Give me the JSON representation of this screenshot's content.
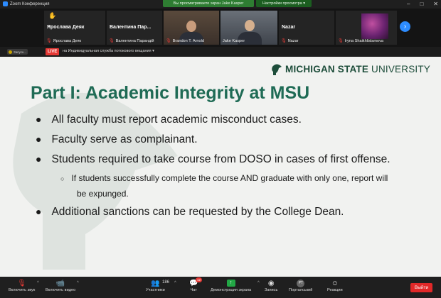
{
  "window": {
    "title": "Zoom Конференция",
    "sharing_banner": "Вы просматриваете экран Jake Kasper",
    "view_options": "Настройки просмотра ▾"
  },
  "gallery": {
    "tiles": [
      {
        "display_name": "Ярослава Деяк",
        "label": "Ярослава Деяк",
        "mic_muted": true,
        "hand_raised": true
      },
      {
        "display_name": "Валентина  Пар...",
        "label": "Валентина Парандій",
        "mic_muted": true
      },
      {
        "display_name": "",
        "label": "Brandon T. Arnold",
        "mic_muted": true,
        "video": true
      },
      {
        "display_name": "",
        "label": "Jake Kasper",
        "mic_muted": false,
        "video": true
      },
      {
        "display_name": "Nazar",
        "label": "Nazar",
        "mic_muted": true
      },
      {
        "display_name": "",
        "label": "Iryna Shaikhlislamova",
        "mic_muted": true,
        "image": true
      }
    ],
    "next_icon": "chevron-right-icon"
  },
  "livebar": {
    "recording_label": "Запуск...",
    "live_label": "LIVE",
    "stream_text": "на Индивидуальная служба потокового вещания ▾"
  },
  "slide": {
    "logo_text_bold": "MICHIGAN STATE",
    "logo_text_regular": " UNIVERSITY",
    "title": "Part I: Academic Integrity at MSU",
    "bullets": [
      {
        "text": "All faculty must report academic misconduct cases."
      },
      {
        "text": "Faculty serve as complainant."
      },
      {
        "text": "Students required to take course from DOSO in cases of first offense."
      },
      {
        "text": "Additional sanctions can be requested by the College Dean."
      }
    ],
    "sub_bullet_line1": "If students successfully complete the course AND graduate with only one, report will",
    "sub_bullet_line2": "be expunged.",
    "colors": {
      "title": "#1f6b55",
      "logo": "#1d4d3a"
    }
  },
  "toolbar": {
    "unmute": "Включить звук",
    "start_video": "Включить видео",
    "participants": "Участники",
    "participants_count": "186",
    "chat": "Чат",
    "chat_badge": "12",
    "share_screen": "Демонстрация экрана",
    "record": "Запись",
    "portal_avatar": "РТ",
    "portal": "Порталський",
    "reactions": "Реакции",
    "leave": "Выйти"
  }
}
